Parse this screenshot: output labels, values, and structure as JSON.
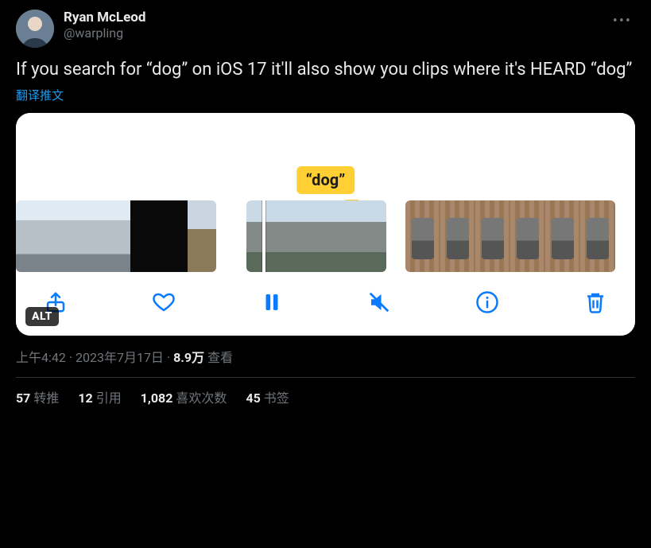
{
  "author": {
    "display_name": "Ryan McLeod",
    "handle": "@warpling"
  },
  "content": {
    "text": "If you search for “dog” on iOS 17 it'll also show you clips where it's HEARD “dog”",
    "translate_label": "翻译推文"
  },
  "media": {
    "search_tag": "“dog”",
    "alt_badge": "ALT",
    "toolbar_icons": {
      "share": "share-icon",
      "heart": "heart-icon",
      "pause": "pause-icon",
      "mute": "mute-icon",
      "info": "info-icon",
      "trash": "trash-icon"
    }
  },
  "meta": {
    "time": "上午4:42",
    "date": "2023年7月17日",
    "separator": " · ",
    "views_number": "8.9万",
    "views_label": " 查看"
  },
  "stats": {
    "retweets": {
      "count": "57",
      "label": "转推"
    },
    "quotes": {
      "count": "12",
      "label": "引用"
    },
    "likes": {
      "count": "1,082",
      "label": "喜欢次数"
    },
    "bookmarks": {
      "count": "45",
      "label": "书签"
    }
  }
}
